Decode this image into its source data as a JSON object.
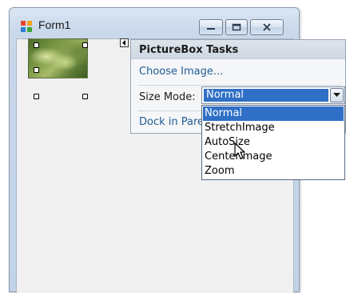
{
  "window": {
    "title": "Form1"
  },
  "tasks_panel": {
    "header": "PictureBox Tasks",
    "choose_image": "Choose Image...",
    "size_mode_label": "Size Mode:",
    "dock_link": "Dock in Pare"
  },
  "size_mode": {
    "selected": "Normal",
    "options": [
      "Normal",
      "StretchImage",
      "AutoSize",
      "CenterImage",
      "Zoom"
    ]
  },
  "icons": {
    "app": "form-app-icon",
    "smart_tag": "smart-tag-arrow-icon",
    "dropdown_arrow": "chevron-down-icon",
    "cursor": "mouse-pointer-icon"
  },
  "colors": {
    "selection": "#2f6fc6",
    "link": "#1f5b92"
  }
}
